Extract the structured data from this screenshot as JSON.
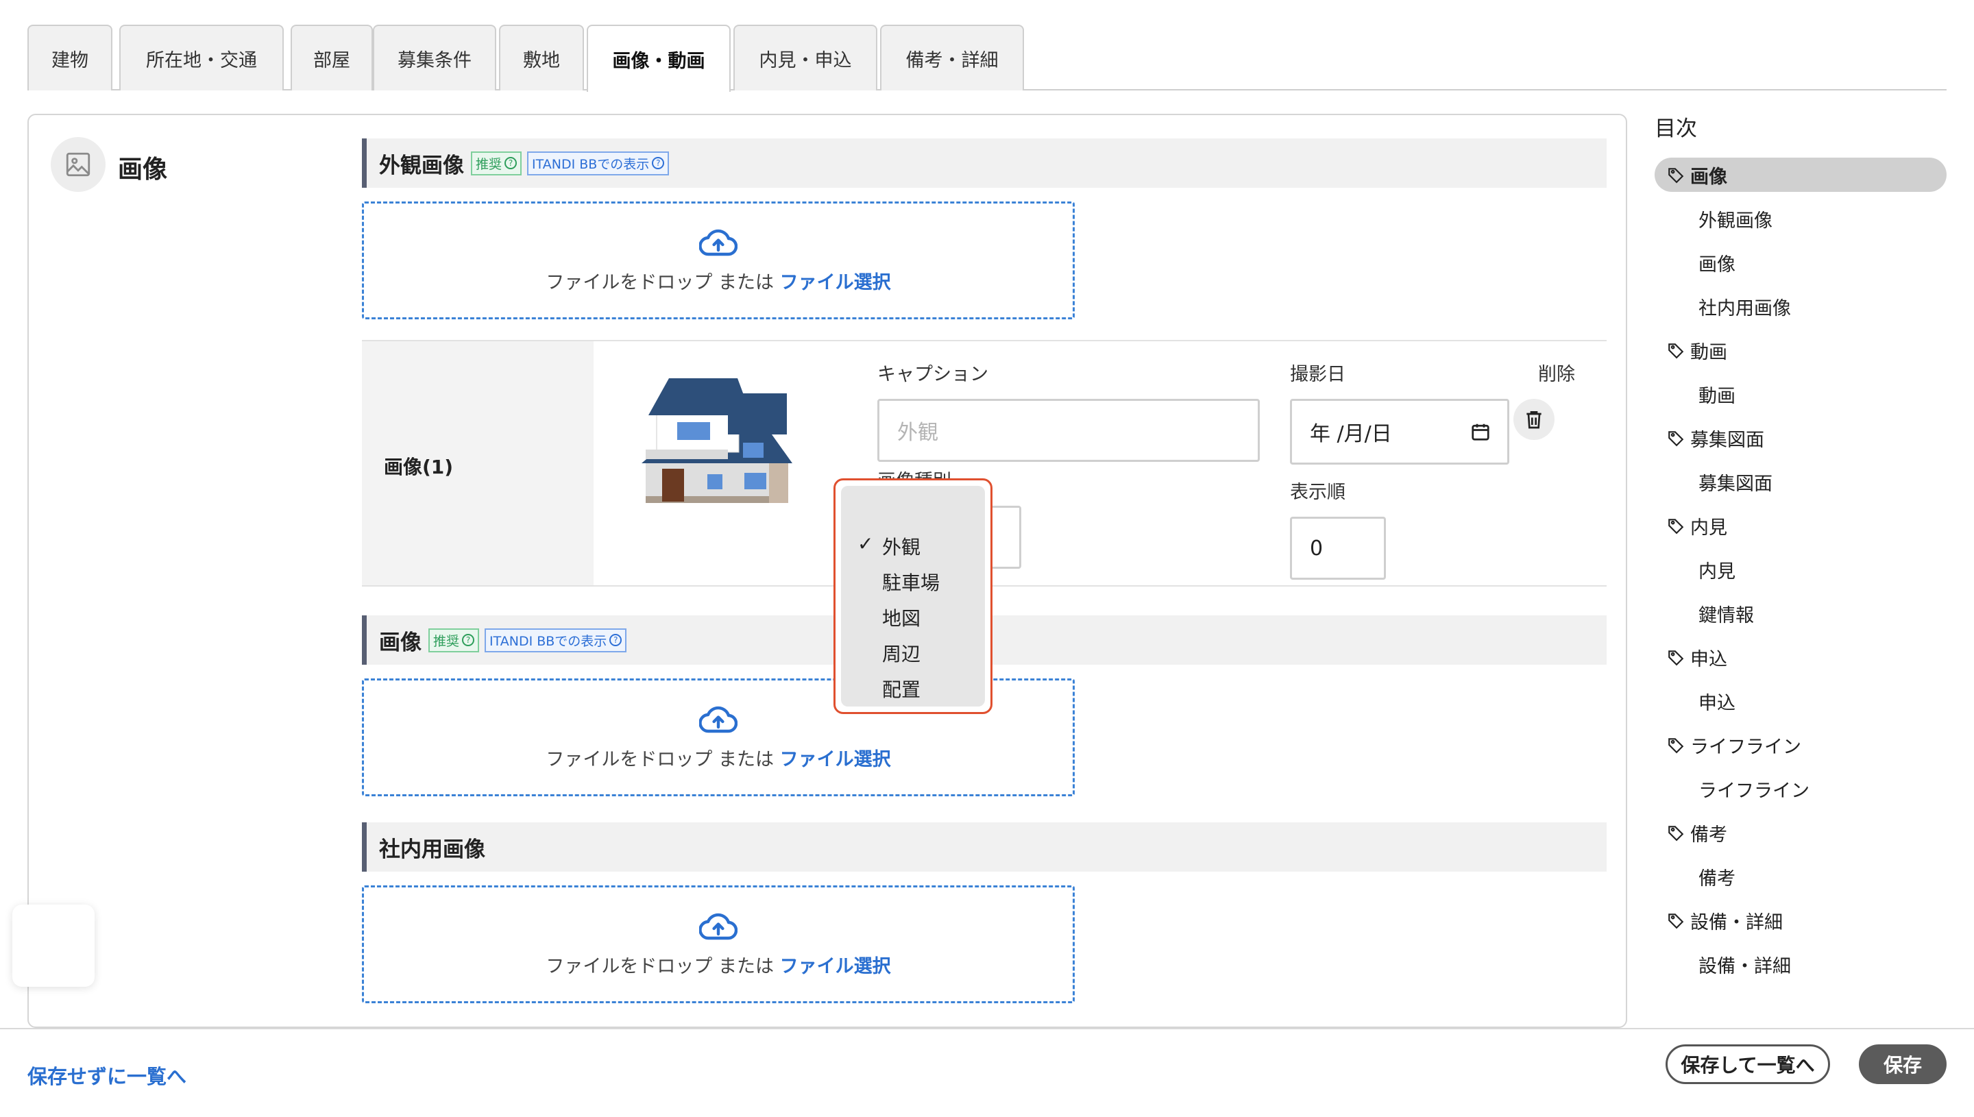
{
  "tabs": [
    {
      "label": "建物",
      "active": false
    },
    {
      "label": "所在地・交通",
      "active": false
    },
    {
      "label": "部屋",
      "active": false
    },
    {
      "label": "募集条件",
      "active": false
    },
    {
      "label": "敷地",
      "active": false
    },
    {
      "label": "画像・動画",
      "active": true
    },
    {
      "label": "内見・申込",
      "active": false
    },
    {
      "label": "備考・詳細",
      "active": false
    }
  ],
  "section": {
    "title": "画像",
    "icon": "image-icon"
  },
  "exterior": {
    "title": "外観画像",
    "badge_recommended": "推奨",
    "badge_itandi": "ITANDI BBでの表示"
  },
  "dropzone": {
    "text": "ファイルをドロップ または ",
    "link": "ファイル選択",
    "icon": "cloud-upload-icon"
  },
  "image_item": {
    "label": "画像(1)",
    "caption_label": "キャプション",
    "caption_placeholder": "外観",
    "type_label": "画像種別",
    "date_label": "撮影日",
    "date_placeholder": "年 /月/日",
    "order_label": "表示順",
    "order_value": "0",
    "delete_label": "削除"
  },
  "type_dropdown": {
    "selected": "外観",
    "options": [
      "外観",
      "駐車場",
      "地図",
      "周辺",
      "配置"
    ]
  },
  "images": {
    "title": "画像",
    "badge_recommended": "推奨",
    "badge_itandi": "ITANDI BBでの表示"
  },
  "internal": {
    "title": "社内用画像"
  },
  "toc": {
    "title": "目次",
    "items": [
      {
        "label": "画像",
        "level": "top",
        "active": true
      },
      {
        "label": "外観画像",
        "level": "sub"
      },
      {
        "label": "画像",
        "level": "sub"
      },
      {
        "label": "社内用画像",
        "level": "sub"
      },
      {
        "label": "動画",
        "level": "top"
      },
      {
        "label": "動画",
        "level": "sub"
      },
      {
        "label": "募集図面",
        "level": "top"
      },
      {
        "label": "募集図面",
        "level": "sub"
      },
      {
        "label": "内見",
        "level": "top"
      },
      {
        "label": "内見",
        "level": "sub"
      },
      {
        "label": "鍵情報",
        "level": "sub"
      },
      {
        "label": "申込",
        "level": "top"
      },
      {
        "label": "申込",
        "level": "sub"
      },
      {
        "label": "ライフライン",
        "level": "top"
      },
      {
        "label": "ライフライン",
        "level": "sub"
      },
      {
        "label": "備考",
        "level": "top"
      },
      {
        "label": "備考",
        "level": "sub"
      },
      {
        "label": "設備・詳細",
        "level": "top"
      },
      {
        "label": "設備・詳細",
        "level": "sub"
      }
    ]
  },
  "footer": {
    "back_link": "保存せずに一覧へ",
    "save_and_list": "保存して一覧へ",
    "save": "保存"
  },
  "colors": {
    "accent": "#2a6fd0",
    "dropdown_border": "#e0502f",
    "dark_button": "#5b5b5b"
  }
}
